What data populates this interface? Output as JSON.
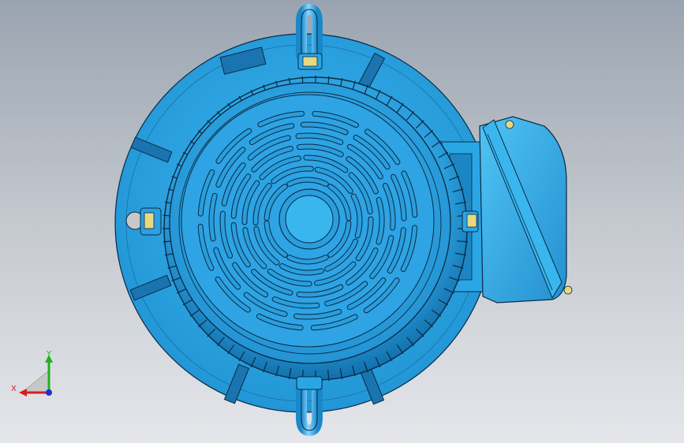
{
  "viewport": {
    "background_top": "#9aa4b0",
    "background_bottom": "#e4e6ea"
  },
  "model": {
    "primary_color": "#28a8e8",
    "dark_color": "#1478b8",
    "outline_color": "#0a2a44",
    "highlight_color": "#8ad8ff",
    "bolt_color": "#e8d880"
  },
  "triad": {
    "x_label": "X",
    "y_label": "Y",
    "x_color": "#d42020",
    "y_color": "#20b020",
    "z_color": "#2030d0"
  }
}
